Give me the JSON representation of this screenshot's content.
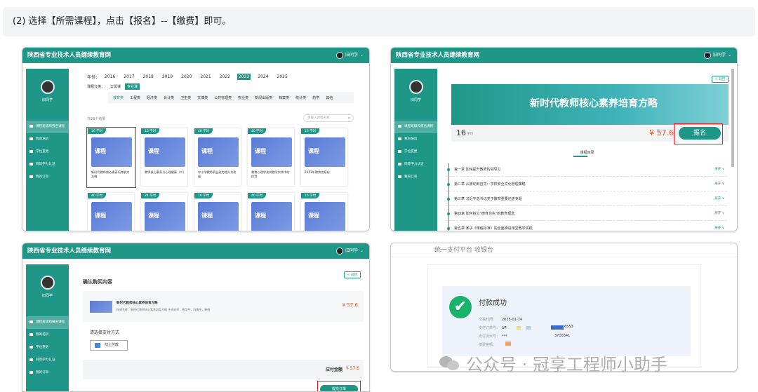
{
  "instruction": "(2) 选择【所需课程】，点击【报名】--【缴费】即可。",
  "site_title": "陕西省专业技术人员继续教育网",
  "user_label": "旧同学",
  "username": "旧同学",
  "sidebar": [
    "课程班级和报名课程",
    "我的培训",
    "学位变更",
    "同等学力认证",
    "我的订单"
  ],
  "years_label": "年份：",
  "years": [
    "2016",
    "2017",
    "2018",
    "2019",
    "2020",
    "2021",
    "2022",
    "2023",
    "2024",
    "2025"
  ],
  "cat_label": "课程分类：",
  "categories": [
    "公需课",
    "专业课"
  ],
  "subtags": [
    "教育类",
    "工程类",
    "经济类",
    "会计类",
    "卫生类",
    "文博类",
    "公共管理类",
    "农业类",
    "新闻出版类",
    "档案类",
    "统计类",
    "药学",
    "其他"
  ],
  "total": "共28个结果",
  "search_placeholder": "请输入课程名称",
  "cards_row1": [
    {
      "badge": "16 学时",
      "title": "新时代教师核心素养培育能力方略"
    },
    {
      "badge": "16 学时",
      "title": "教师核心素养与心理健康（二）"
    },
    {
      "badge": "40 学时",
      "title": "中小学教师职业能力提升与发展"
    },
    {
      "badge": "40 学时",
      "title": "教育心理学及其教学实践中的应用"
    },
    {
      "badge": "16 学时",
      "title": "2023年教育信息化"
    }
  ],
  "cards_row2": [
    "40 学时",
    "24 学时",
    "16 学时",
    "40 学时",
    "16 学时"
  ],
  "thumb_label": "课程",
  "back_label": "< 返回",
  "course_title": "新时代教师核心素养培育方略",
  "hours": "16",
  "hours_unit": "学时",
  "price": "¥ 57.6",
  "enroll": "报名",
  "catalog_title": "课程目录",
  "expand": "展开 ∨",
  "chapters": [
    "第一章 如何提升教师的领导力",
    "第二章 从被动到自觉：学校安全文化管理策略",
    "第三章 习近平总书记关于教育重要论述专题",
    "第四章 如何树立\"德育为先\"的教育理念",
    "第五章 某乎《课程标准》的全面推进课堂教学实践"
  ],
  "confirm_title": "确认购买内容",
  "order_course": "新时代教师核心素养培育方略",
  "order_detail": "授课名称：新时代教师核心素养培育方略 主讲老师：杨华平，冯倩平，杨燕",
  "order_price": "¥ 57.6",
  "pay_method_label": "请选择支付方式",
  "pay_option": "线上付款",
  "payable_label": "应付金额",
  "payable_value": "¥ 57.6",
  "submit": "提交订单",
  "pay_platform": "统一支付平台  收银台",
  "pay_success": "付款成功",
  "pay_fields": [
    {
      "label": "交易时间：",
      "value": "2025-01-14"
    },
    {
      "label": "支付订单号：",
      "value": "UP"
    },
    {
      "label": "支付流水号：",
      "value": "***"
    },
    {
      "label": "缴费金额：",
      "value": ""
    }
  ],
  "order_no_tail": "6553",
  "serial_tail": "3710341",
  "watermark": "公众号 · 冠享工程师小助手"
}
